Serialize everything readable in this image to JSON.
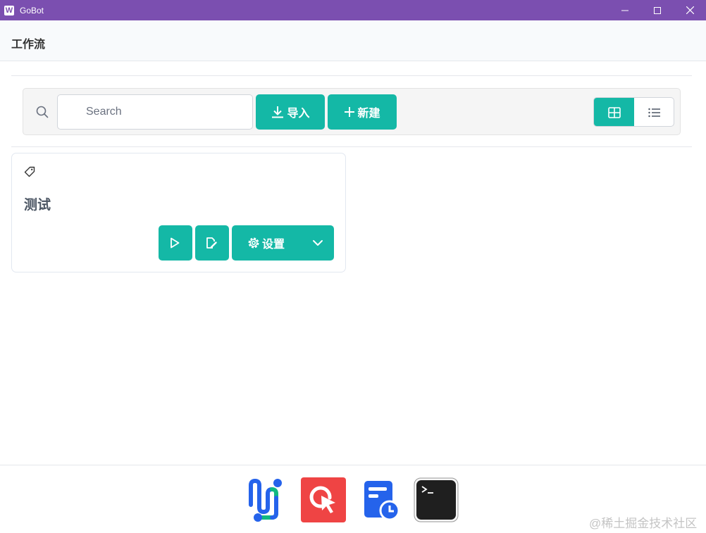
{
  "window": {
    "app_logo_letter": "W",
    "title": "GoBot"
  },
  "header": {
    "title": "工作流"
  },
  "toolbar": {
    "search_placeholder": "Search",
    "import_label": "导入",
    "new_label": "新建",
    "view_mode": "grid"
  },
  "workflows": [
    {
      "name": "测试",
      "settings_label": "设置"
    }
  ],
  "dock": {
    "items": [
      {
        "icon": "workflow-app-icon"
      },
      {
        "icon": "click-app-icon"
      },
      {
        "icon": "schedule-app-icon"
      },
      {
        "icon": "terminal-app-icon"
      }
    ]
  },
  "watermark": "@稀土掘金技术社区",
  "colors": {
    "titlebar": "#7b4fb0",
    "accent": "#14b8a6"
  }
}
